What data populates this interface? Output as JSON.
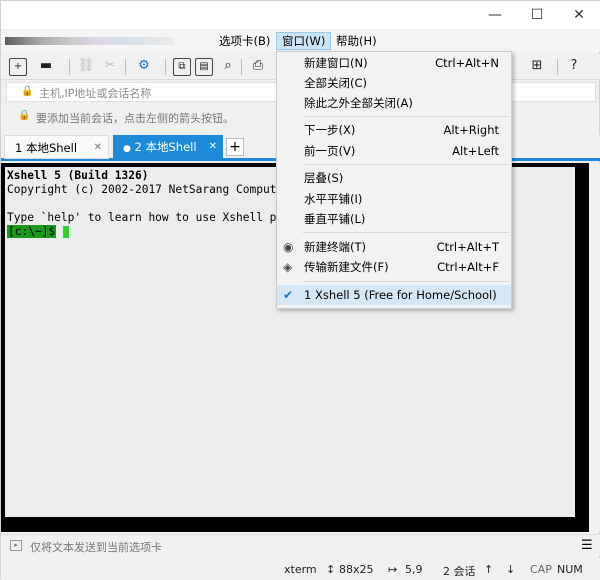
{
  "window": {
    "minimize_glyph": "—",
    "maximize_glyph": "☐",
    "close_glyph": "✕"
  },
  "menubar": {
    "items": [
      {
        "label": "选项卡(B)"
      },
      {
        "label": "窗口(W)"
      },
      {
        "label": "帮助(H)"
      }
    ]
  },
  "address": {
    "placeholder": "主机,IP地址或会话名称"
  },
  "hint": {
    "text": "要添加当前会话，点击左侧的箭头按钮。"
  },
  "tabs": [
    {
      "label": "1 本地Shell",
      "active": false
    },
    {
      "label": "2 本地Shell",
      "active": true
    }
  ],
  "terminal": {
    "lines": [
      "Xshell 5 (Build 1326)",
      "Copyright (c) 2002-2017 NetSarang Computer, Inc. All rights reserved.",
      "",
      "Type `help' to learn how to use Xshell prompt."
    ],
    "prompt": "[c:\\~]$"
  },
  "sendbar": {
    "placeholder": "仅将文本发送到当前选项卡"
  },
  "status": {
    "term": "xterm",
    "size": "88x25",
    "pos": "5,9",
    "sessions": "2 会话",
    "cap": "CAP",
    "num": "NUM"
  },
  "window_menu": {
    "items": [
      {
        "label": "新建窗口(N)",
        "shortcut": "Ctrl+Alt+N"
      },
      {
        "label": "全部关闭(C)",
        "shortcut": ""
      },
      {
        "label": "除此之外全部关闭(A)",
        "shortcut": ""
      },
      {
        "label": "下一步(X)",
        "shortcut": "Alt+Right"
      },
      {
        "label": "前一页(V)",
        "shortcut": "Alt+Left"
      },
      {
        "label": "层叠(S)",
        "shortcut": ""
      },
      {
        "label": "水平平铺(I)",
        "shortcut": ""
      },
      {
        "label": "垂直平铺(L)",
        "shortcut": ""
      },
      {
        "label": "新建终端(T)",
        "shortcut": "Ctrl+Alt+T",
        "icon": "terminal-icon"
      },
      {
        "label": "传输新建文件(F)",
        "shortcut": "Ctrl+Alt+F",
        "icon": "transfer-icon"
      },
      {
        "label": "1 Xshell 5 (Free for Home/School)",
        "shortcut": "",
        "checked": true
      }
    ]
  },
  "colors": {
    "accent": "#1c8ad9",
    "terminal_bg": "#ececec",
    "prompt_bg": "#1a9a1a"
  }
}
